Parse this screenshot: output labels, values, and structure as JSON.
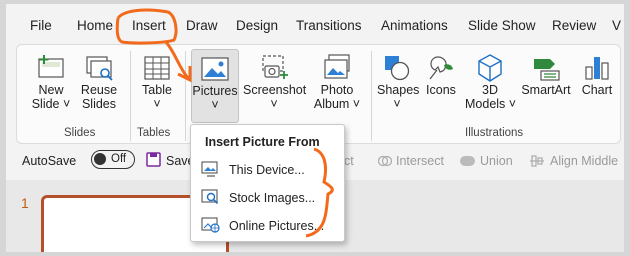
{
  "tabs": [
    "File",
    "Home",
    "Insert",
    "Draw",
    "Design",
    "Transitions",
    "Animations",
    "Slide Show",
    "Review",
    "V"
  ],
  "ribbon": {
    "new_slide": [
      "New",
      "Slide ˅"
    ],
    "reuse_slides": [
      "Reuse",
      "Slides"
    ],
    "table": [
      "Table",
      "˅"
    ],
    "pictures": [
      "Pictures",
      "˅"
    ],
    "screenshot": [
      "Screenshot",
      "˅"
    ],
    "photo_album": [
      "Photo",
      "Album ˅"
    ],
    "shapes": [
      "Shapes",
      "˅"
    ],
    "icons": "Icons",
    "models_3d": [
      "3D",
      "Models ˅"
    ],
    "smartart": "SmartArt",
    "chart": "Chart",
    "groups": {
      "slides": "Slides",
      "tables": "Tables",
      "illustrations": "Illustrations"
    }
  },
  "qat": {
    "autosave": "AutoSave",
    "toggle": "Off",
    "save": "Save",
    "subtract": "ct",
    "intersect": "Intersect",
    "union": "Union",
    "align_middle": "Align Middle"
  },
  "slide_panel": {
    "number": "1"
  },
  "dropdown": {
    "header": "Insert Picture From",
    "items": [
      "This Device...",
      "Stock Images...",
      "Online Pictures..."
    ]
  },
  "colors": {
    "annotation": "#f26b1d",
    "accent_orange": "#c55a11",
    "selected_bg": "#e2e2e2"
  }
}
